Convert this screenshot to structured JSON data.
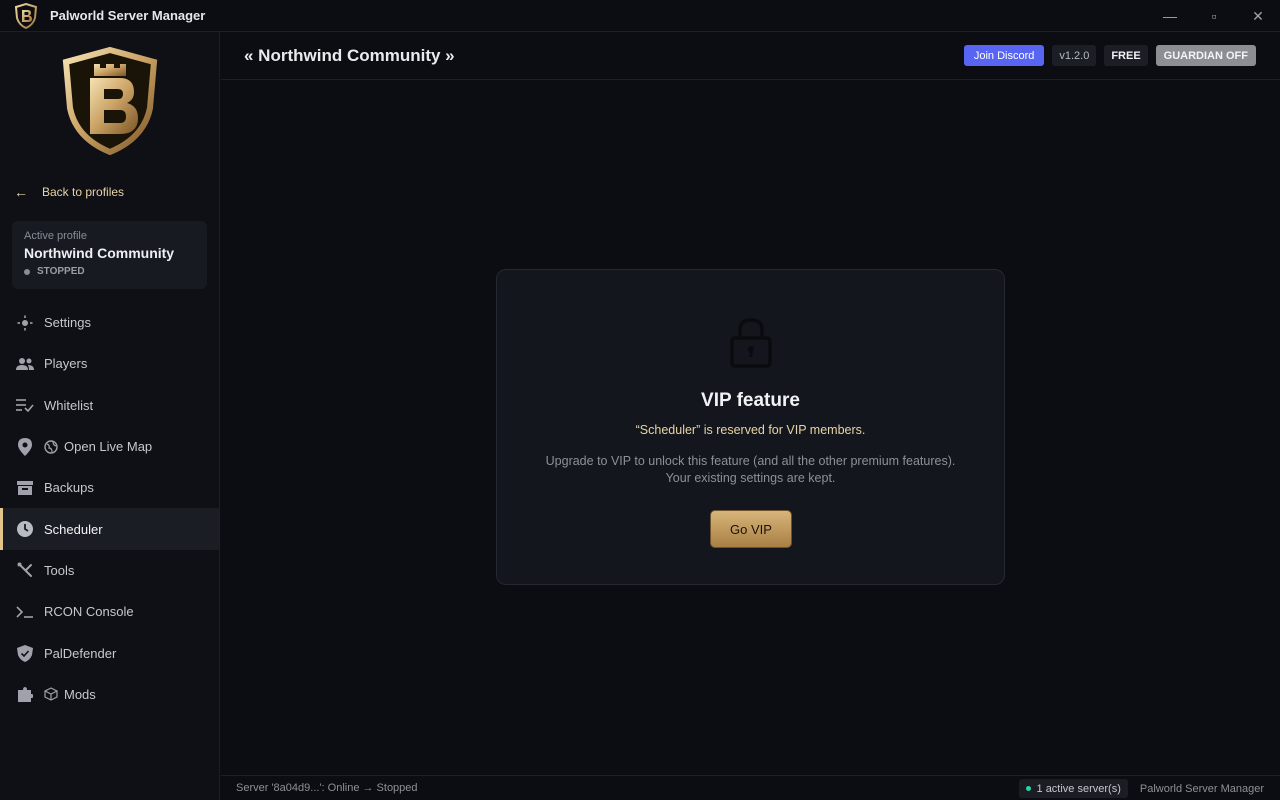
{
  "titlebar": {
    "title": "Palworld Server Manager",
    "minimize": "—",
    "maximize": "▫",
    "close": "✕"
  },
  "sidebar": {
    "back_label": "Back to profiles",
    "profile": {
      "label": "Active profile",
      "name": "Northwind Community",
      "status": "STOPPED"
    },
    "items": [
      {
        "label": "Settings",
        "icon": "settings-icon"
      },
      {
        "label": "Players",
        "icon": "players-icon"
      },
      {
        "label": "Whitelist",
        "icon": "whitelist-icon"
      },
      {
        "label": "Open Live Map",
        "icon": "map-pin-icon"
      },
      {
        "label": "Backups",
        "icon": "archive-icon"
      },
      {
        "label": "Scheduler",
        "icon": "clock-icon"
      },
      {
        "label": "Tools",
        "icon": "tools-icon"
      },
      {
        "label": "RCON Console",
        "icon": "terminal-icon"
      },
      {
        "label": "PalDefender",
        "icon": "shield-icon"
      },
      {
        "label": "Mods",
        "icon": "puzzle-icon"
      }
    ]
  },
  "header": {
    "title": "« Northwind Community »",
    "discord_label": "Join Discord",
    "version": "v1.2.0",
    "plan": "FREE",
    "guardian": "GUARDIAN OFF"
  },
  "vip": {
    "title": "VIP feature",
    "reserved": "“Scheduler” is reserved for VIP members.",
    "desc_line1": "Upgrade to VIP to unlock this feature (and all the other premium features).",
    "desc_line2": "Your existing settings are kept.",
    "button": "Go VIP"
  },
  "statusbar": {
    "message": "Server '8a04d9...': Online → Stopped",
    "active_servers": "1 active server(s)",
    "app_name": "Palworld Server Manager"
  },
  "colors": {
    "accent_gold": "#e3c48a",
    "discord": "#5865f2",
    "online_green": "#2ed3a0"
  }
}
